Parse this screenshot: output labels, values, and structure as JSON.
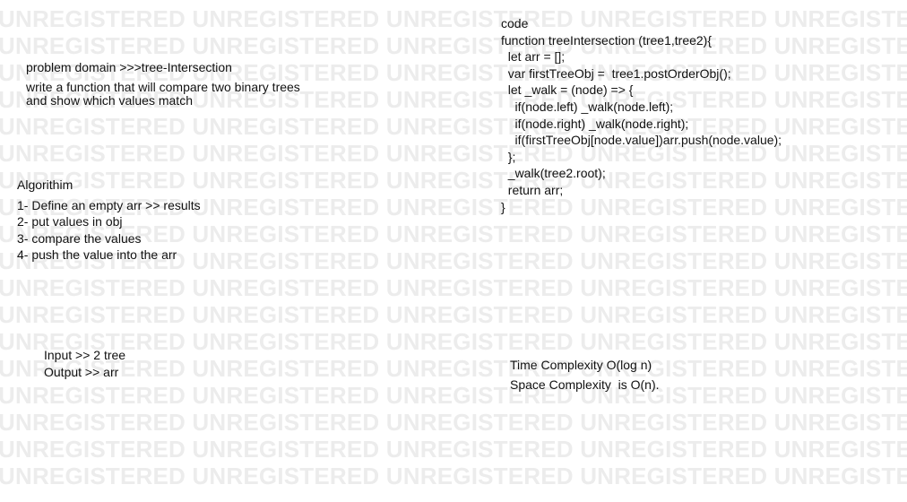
{
  "watermark": {
    "text": "UNREGISTERED UNREGISTERED UNREGISTERED UNREGISTERED UNREGISTERED UNREGISTERED",
    "rows": 18
  },
  "problem": {
    "title": "problem domain >>>tree-Intersection",
    "desc_line1": "write a function that will compare two binary trees",
    "desc_line2": "and show which values match"
  },
  "algorithm": {
    "title": "Algorithim",
    "steps": [
      "1- Define an empty arr >> results",
      "2- put values in obj",
      "3- compare the values",
      "4- push the value into the arr"
    ]
  },
  "io": {
    "input": "Input >> 2 tree",
    "output": "Output >> arr"
  },
  "code": {
    "title": "code",
    "lines": [
      "function treeIntersection (tree1,tree2){",
      "  let arr = [];",
      "  var firstTreeObj =  tree1.postOrderObj();",
      "  let _walk = (node) => {",
      "    if(node.left) _walk(node.left);",
      "    if(node.right) _walk(node.right);",
      "    if(firstTreeObj[node.value])arr.push(node.value);",
      "  };",
      "  _walk(tree2.root);",
      "  return arr;",
      "}"
    ]
  },
  "complexity": {
    "time": "Time Complexity O(log n)",
    "space": "Space Complexity  is O(n)."
  }
}
